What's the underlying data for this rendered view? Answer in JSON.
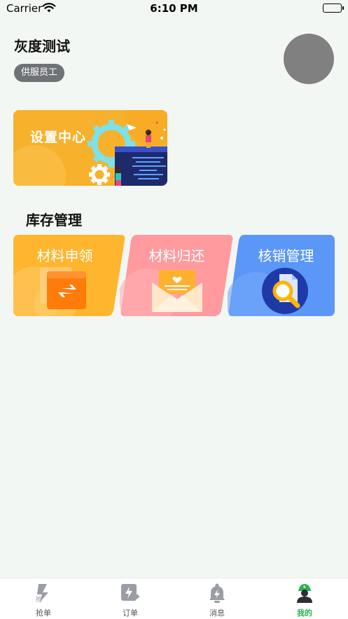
{
  "status_bar": {
    "carrier": "Carrier",
    "time": "6:10 PM"
  },
  "profile": {
    "name": "灰度测试",
    "role": "供服员工"
  },
  "settings_card": {
    "label": "设置中心"
  },
  "inventory": {
    "title": "库存管理",
    "tiles": [
      {
        "label": "材料申领",
        "color": "#ffb52e"
      },
      {
        "label": "材料归还",
        "color": "#ff9a9f"
      },
      {
        "label": "核销管理",
        "color": "#5a97f7"
      }
    ]
  },
  "tab_bar": {
    "tabs": [
      {
        "label": "抢单",
        "icon": "grab-order-icon"
      },
      {
        "label": "订单",
        "icon": "order-icon"
      },
      {
        "label": "消息",
        "icon": "message-bell-icon"
      },
      {
        "label": "我的",
        "icon": "worker-profile-icon",
        "active": true
      }
    ],
    "active_color": "#2bb24c"
  }
}
